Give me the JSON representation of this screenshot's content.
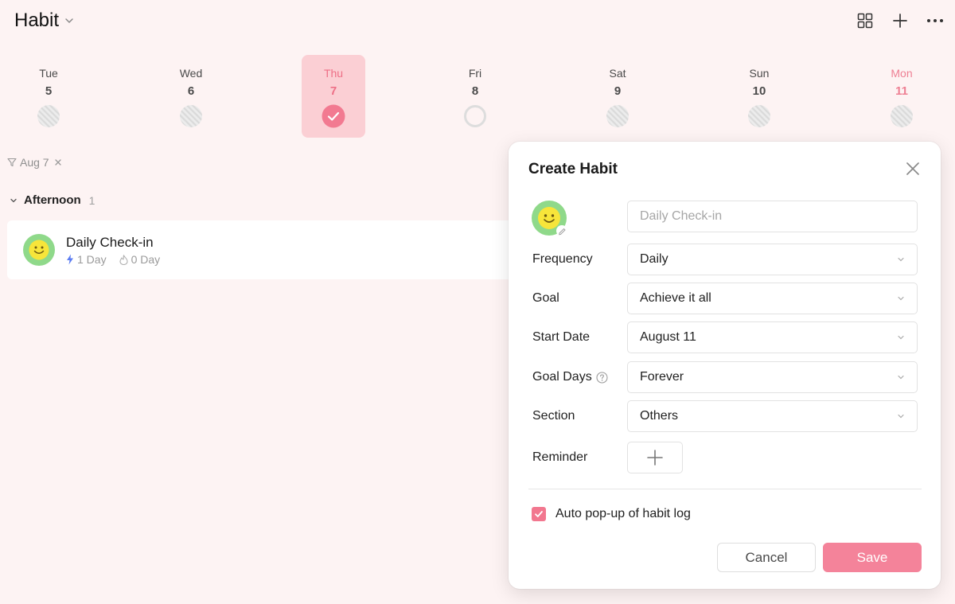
{
  "header": {
    "title": "Habit",
    "icons": [
      "chevron-down-icon",
      "grid-view-icon",
      "plus-icon",
      "more-icon"
    ]
  },
  "week": [
    {
      "name": "Tue",
      "num": "5",
      "status": "missed"
    },
    {
      "name": "Wed",
      "num": "6",
      "status": "missed"
    },
    {
      "name": "Thu",
      "num": "7",
      "status": "done"
    },
    {
      "name": "Fri",
      "num": "8",
      "status": "empty"
    },
    {
      "name": "Sat",
      "num": "9",
      "status": "missed"
    },
    {
      "name": "Sun",
      "num": "10",
      "status": "missed"
    },
    {
      "name": "Mon",
      "num": "11",
      "status": "missed"
    }
  ],
  "filter": {
    "label": "Aug 7"
  },
  "section": {
    "name": "Afternoon",
    "count": "1"
  },
  "habit": {
    "name": "Daily Check-in",
    "streak": "1 Day",
    "total": "0 Day"
  },
  "modal": {
    "title": "Create Habit",
    "name_placeholder": "Daily Check-in",
    "fields": {
      "frequency": {
        "label": "Frequency",
        "value": "Daily"
      },
      "goal": {
        "label": "Goal",
        "value": "Achieve it all"
      },
      "start_date": {
        "label": "Start Date",
        "value": "August 11"
      },
      "goal_days": {
        "label": "Goal Days",
        "value": "Forever"
      },
      "section": {
        "label": "Section",
        "value": "Others"
      },
      "reminder": {
        "label": "Reminder"
      }
    },
    "auto_popup": {
      "label": "Auto pop-up of habit log",
      "checked": true
    },
    "cancel_label": "Cancel",
    "save_label": "Save"
  },
  "colors": {
    "accent": "#f4839a",
    "today_bg": "#fbcfd4",
    "background": "#fdf3f3"
  }
}
